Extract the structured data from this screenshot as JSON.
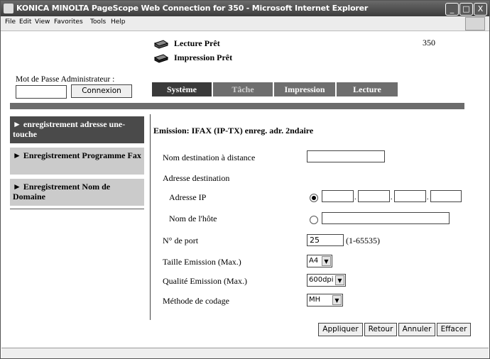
{
  "window": {
    "title": "KONICA MINOLTA PageScope Web Connection for 350 - Microsoft Internet Explorer",
    "controls": [
      "_",
      "□",
      "X"
    ]
  },
  "menu": [
    "File",
    "Edit",
    "View",
    "Favorites",
    "Tools",
    "Help"
  ],
  "header": {
    "status1": "Lecture Prêt",
    "status2": "Impression Prêt",
    "model": "350",
    "password_label": "Mot de Passe Administrateur :",
    "password_value": "",
    "login_button": "Connexion"
  },
  "tabs": [
    "Système",
    "Tâche",
    "Impression",
    "Lecture"
  ],
  "sidebar": {
    "items": [
      {
        "label": "► enregistrement adresse une-touche",
        "active": true
      },
      {
        "label": "► Enregistrement Programme Fax",
        "active": false
      },
      {
        "label": "► Enregistrement Nom de Domaine",
        "active": false
      }
    ]
  },
  "form": {
    "heading": "Emission: IFAX (IP-TX)  enreg. adr. 2ndaire",
    "remote_name_label": "Nom destination à distance",
    "remote_name_value": "",
    "dest_address_label": "Adresse destination",
    "ip_label": "Adresse IP",
    "ip_selected": true,
    "ip_octets": [
      "",
      "",
      "",
      ""
    ],
    "host_label": "Nom de l'hôte",
    "host_value": "",
    "port_label": "N° de port",
    "port_value": "25",
    "port_range": "(1-65535)",
    "size_label": "Taille Emission (Max.)",
    "size_value": "A4",
    "quality_label": "Qualité Emission (Max.)",
    "quality_value": "600dpi",
    "coding_label": "Méthode de codage",
    "coding_value": "MH"
  },
  "buttons": {
    "apply": "Appliquer",
    "back": "Retour",
    "cancel": "Annuler",
    "clear": "Effacer"
  }
}
